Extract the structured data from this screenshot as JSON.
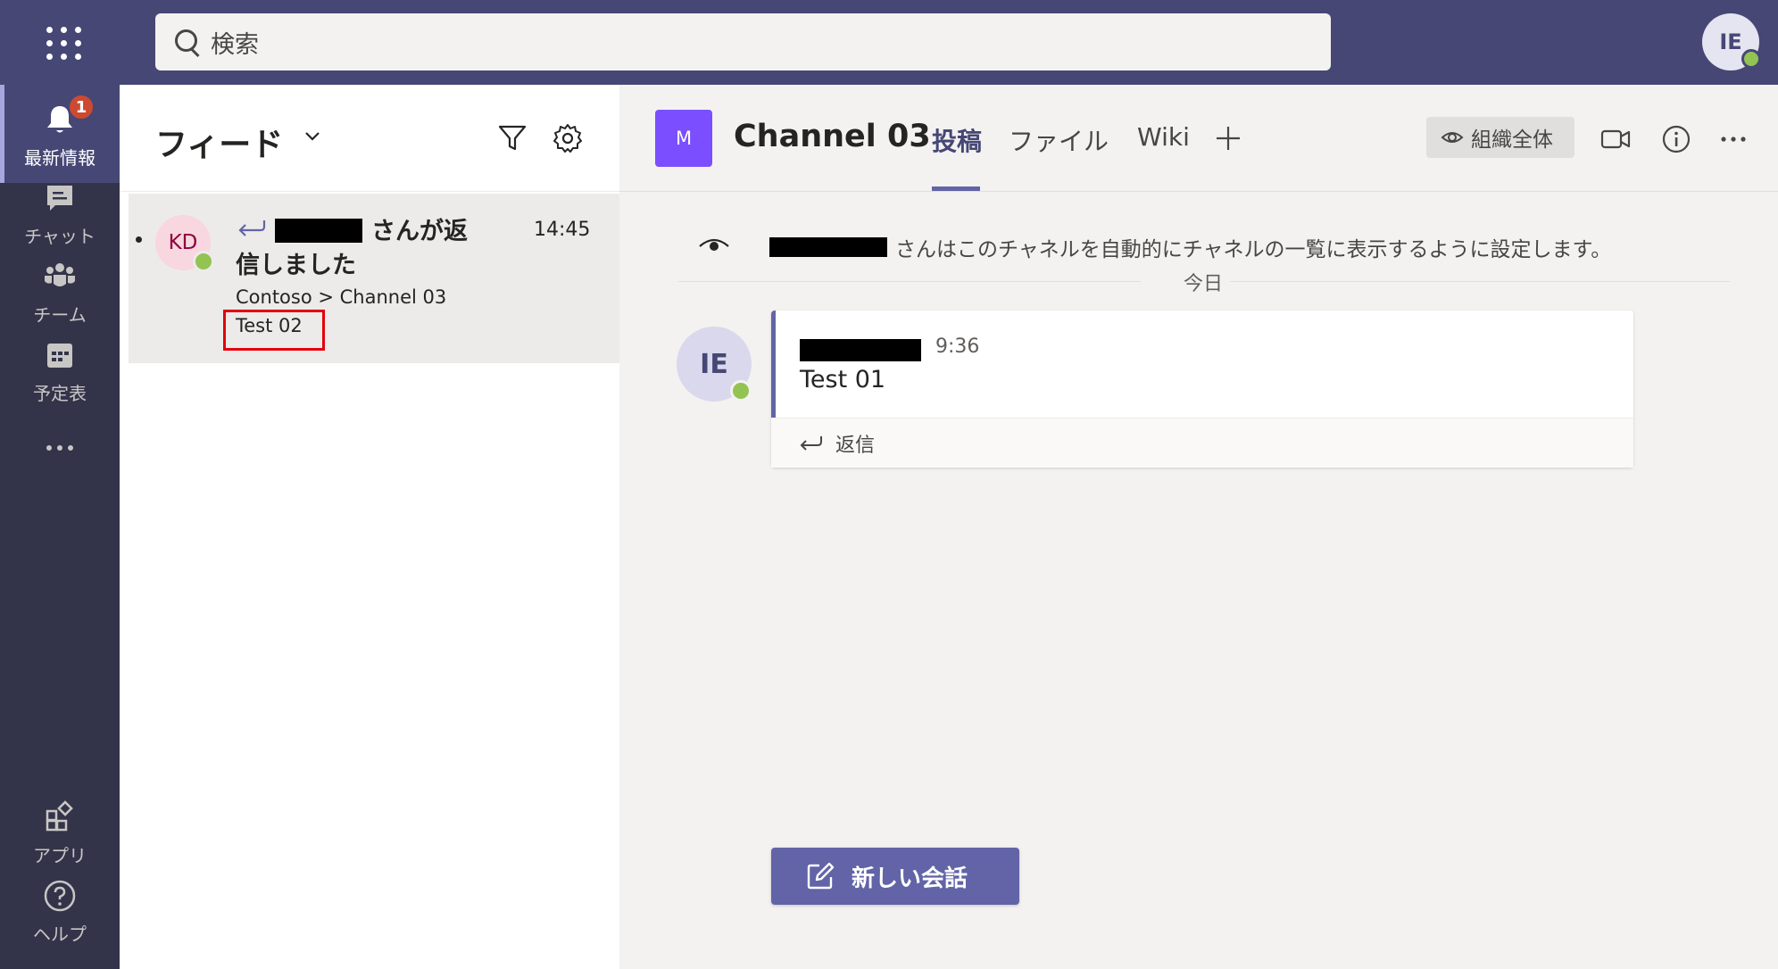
{
  "search": {
    "placeholder": "検索"
  },
  "user": {
    "initials": "IE"
  },
  "rail": {
    "items": [
      {
        "label": "最新情報",
        "badge": "1"
      },
      {
        "label": "チャット"
      },
      {
        "label": "チーム"
      },
      {
        "label": "予定表"
      },
      {
        "label": "アプリ"
      },
      {
        "label": "ヘルプ"
      }
    ]
  },
  "feed": {
    "title": "フィード",
    "item": {
      "initials": "KD",
      "title_part1": "さんが返",
      "title_part2": "信しました",
      "time": "14:45",
      "path": "Contoso > Channel 03",
      "message": "Test 02"
    }
  },
  "channel": {
    "tile_letter": "M",
    "name": "Channel 03",
    "tabs": [
      "投稿",
      "ファイル",
      "Wiki"
    ],
    "org_label": "組織全体"
  },
  "conversation": {
    "system_text": "さんはこのチャネルを自動的にチャネルの一覧に表示するように設定します。",
    "day_label": "今日",
    "post": {
      "initials": "IE",
      "time": "9:36",
      "body": "Test 01",
      "reply_label": "返信"
    },
    "new_conversation_label": "新しい会話"
  },
  "colors": {
    "topbar": "#464775",
    "rail": "#33344a",
    "accent": "#6264a7",
    "presence": "#92c353",
    "badge": "#cc4a31",
    "highlight": "#e3000b"
  }
}
